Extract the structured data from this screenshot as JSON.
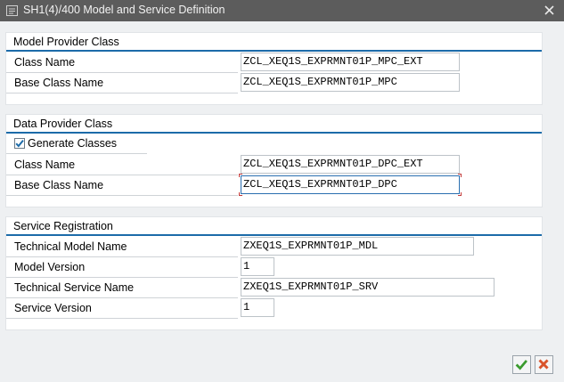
{
  "window": {
    "title": "SH1(4)/400 Model and Service Definition",
    "icon": "dialog-icon",
    "close_icon": "close-icon"
  },
  "model_provider": {
    "title": "Model Provider Class",
    "class_name_label": "Class Name",
    "class_name_value": "ZCL_XEQ1S_EXPRMNT01P_MPC_EXT",
    "base_class_label": "Base Class Name",
    "base_class_value": "ZCL_XEQ1S_EXPRMNT01P_MPC"
  },
  "data_provider": {
    "title": "Data Provider Class",
    "generate_label": "Generate Classes",
    "generate_checked": true,
    "class_name_label": "Class Name",
    "class_name_value": "ZCL_XEQ1S_EXPRMNT01P_DPC_EXT",
    "base_class_label": "Base Class Name",
    "base_class_value": "ZCL_XEQ1S_EXPRMNT01P_DPC"
  },
  "service_registration": {
    "title": "Service Registration",
    "tech_model_label": "Technical Model Name",
    "tech_model_value": "ZXEQ1S_EXPRMNT01P_MDL",
    "model_version_label": "Model Version",
    "model_version_value": "1",
    "tech_service_label": "Technical Service Name",
    "tech_service_value": "ZXEQ1S_EXPRMNT01P_SRV",
    "service_version_label": "Service Version",
    "service_version_value": "1"
  },
  "footer": {
    "ok_icon": "checkmark-icon",
    "cancel_icon": "cancel-x-icon",
    "ok_color": "#3a9b2e",
    "cancel_color": "#d9532b"
  },
  "colors": {
    "titlebar": "#5c5c5c",
    "accent": "#1c6ba9"
  }
}
